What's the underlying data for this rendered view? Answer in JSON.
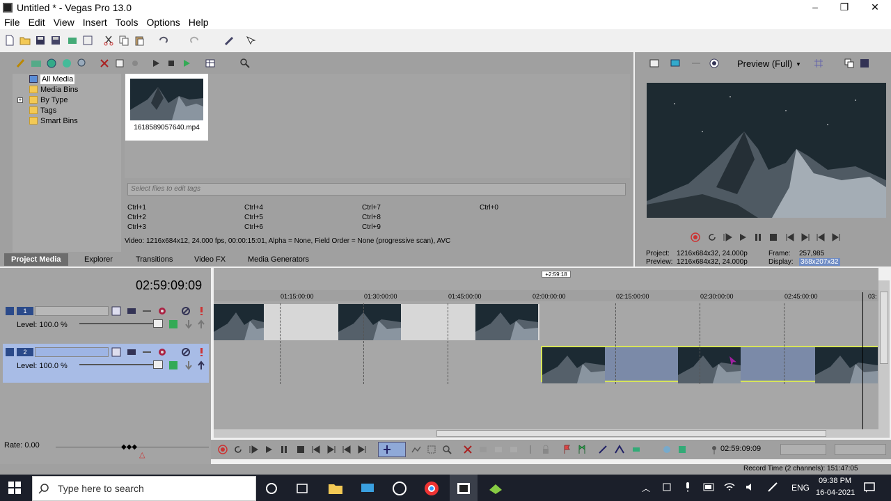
{
  "window": {
    "title": "Untitled * - Vegas Pro 13.0",
    "minimize": "–",
    "maximize": "❐",
    "close": "✕"
  },
  "menu": [
    "File",
    "Edit",
    "View",
    "Insert",
    "Tools",
    "Options",
    "Help"
  ],
  "media_tree": {
    "items": [
      "All Media",
      "Media Bins",
      "By Type",
      "Tags",
      "Smart Bins"
    ]
  },
  "media": {
    "file_name": "1618589057640.mp4",
    "tags_placeholder": "Select files to edit tags",
    "shortcuts": [
      [
        "Ctrl+1",
        "Ctrl+4",
        "Ctrl+7",
        "Ctrl+0"
      ],
      [
        "Ctrl+2",
        "Ctrl+5",
        "Ctrl+8"
      ],
      [
        "Ctrl+3",
        "Ctrl+6",
        "Ctrl+9"
      ]
    ],
    "video_info": "Video: 1216x684x12, 24.000 fps, 00:00:15:01, Alpha = None, Field Order = None (progressive scan), AVC"
  },
  "tabs": [
    "Project Media",
    "Explorer",
    "Transitions",
    "Video FX",
    "Media Generators"
  ],
  "preview": {
    "mode": "Preview (Full)",
    "project_label": "Project:",
    "project_value": "1216x684x32, 24.000p",
    "preview_label": "Preview:",
    "preview_value": "1216x684x32, 24.000p",
    "frame_label": "Frame:",
    "frame_value": "257,985",
    "display_label": "Display:",
    "display_value": "368x207x32"
  },
  "timeline": {
    "timecode": "02:59:09:09",
    "cursor_label": "+2:59:18",
    "ruler": [
      "01:15:00:00",
      "01:30:00:00",
      "01:45:00:00",
      "02:00:00:00",
      "02:15:00:00",
      "02:30:00:00",
      "02:45:00:00",
      "03:"
    ],
    "tracks": [
      {
        "number": "1",
        "level": "Level: 100.0 %"
      },
      {
        "number": "2",
        "level": "Level: 100.0 %"
      }
    ],
    "rate": "Rate: 0.00"
  },
  "transport": {
    "time": "02:59:09:09"
  },
  "status": {
    "record_time": "Record Time (2 channels): 151:47:05"
  },
  "taskbar": {
    "search_placeholder": "Type here to search",
    "lang": "ENG",
    "time": "09:38 PM",
    "date": "16-04-2021"
  }
}
